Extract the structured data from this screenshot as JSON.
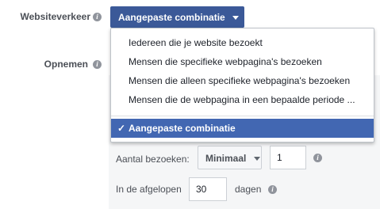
{
  "traffic": {
    "label": "Websiteverkeer",
    "selected": "Aangepaste combinatie",
    "options": [
      "Iedereen die je website bezoekt",
      "Mensen die specifieke webpagina's bezoeken",
      "Mensen die alleen specifieke webpagina's bezoeken",
      "Mensen die de webpagina in een bepaalde periode ..."
    ],
    "selected_option": "Aangepaste combinatie",
    "check_glyph": "✓"
  },
  "include": {
    "label": "Opnemen"
  },
  "visits": {
    "label": "Aantal bezoeken:",
    "mode": "Minimaal",
    "count": "1"
  },
  "period": {
    "prefix": "In de afgelopen",
    "days": "30",
    "suffix": "dagen"
  },
  "icons": {
    "info": "i"
  },
  "colors": {
    "accent": "#3b5998",
    "selected_row": "#4267b2",
    "panel_bg": "#f5f6f7"
  }
}
